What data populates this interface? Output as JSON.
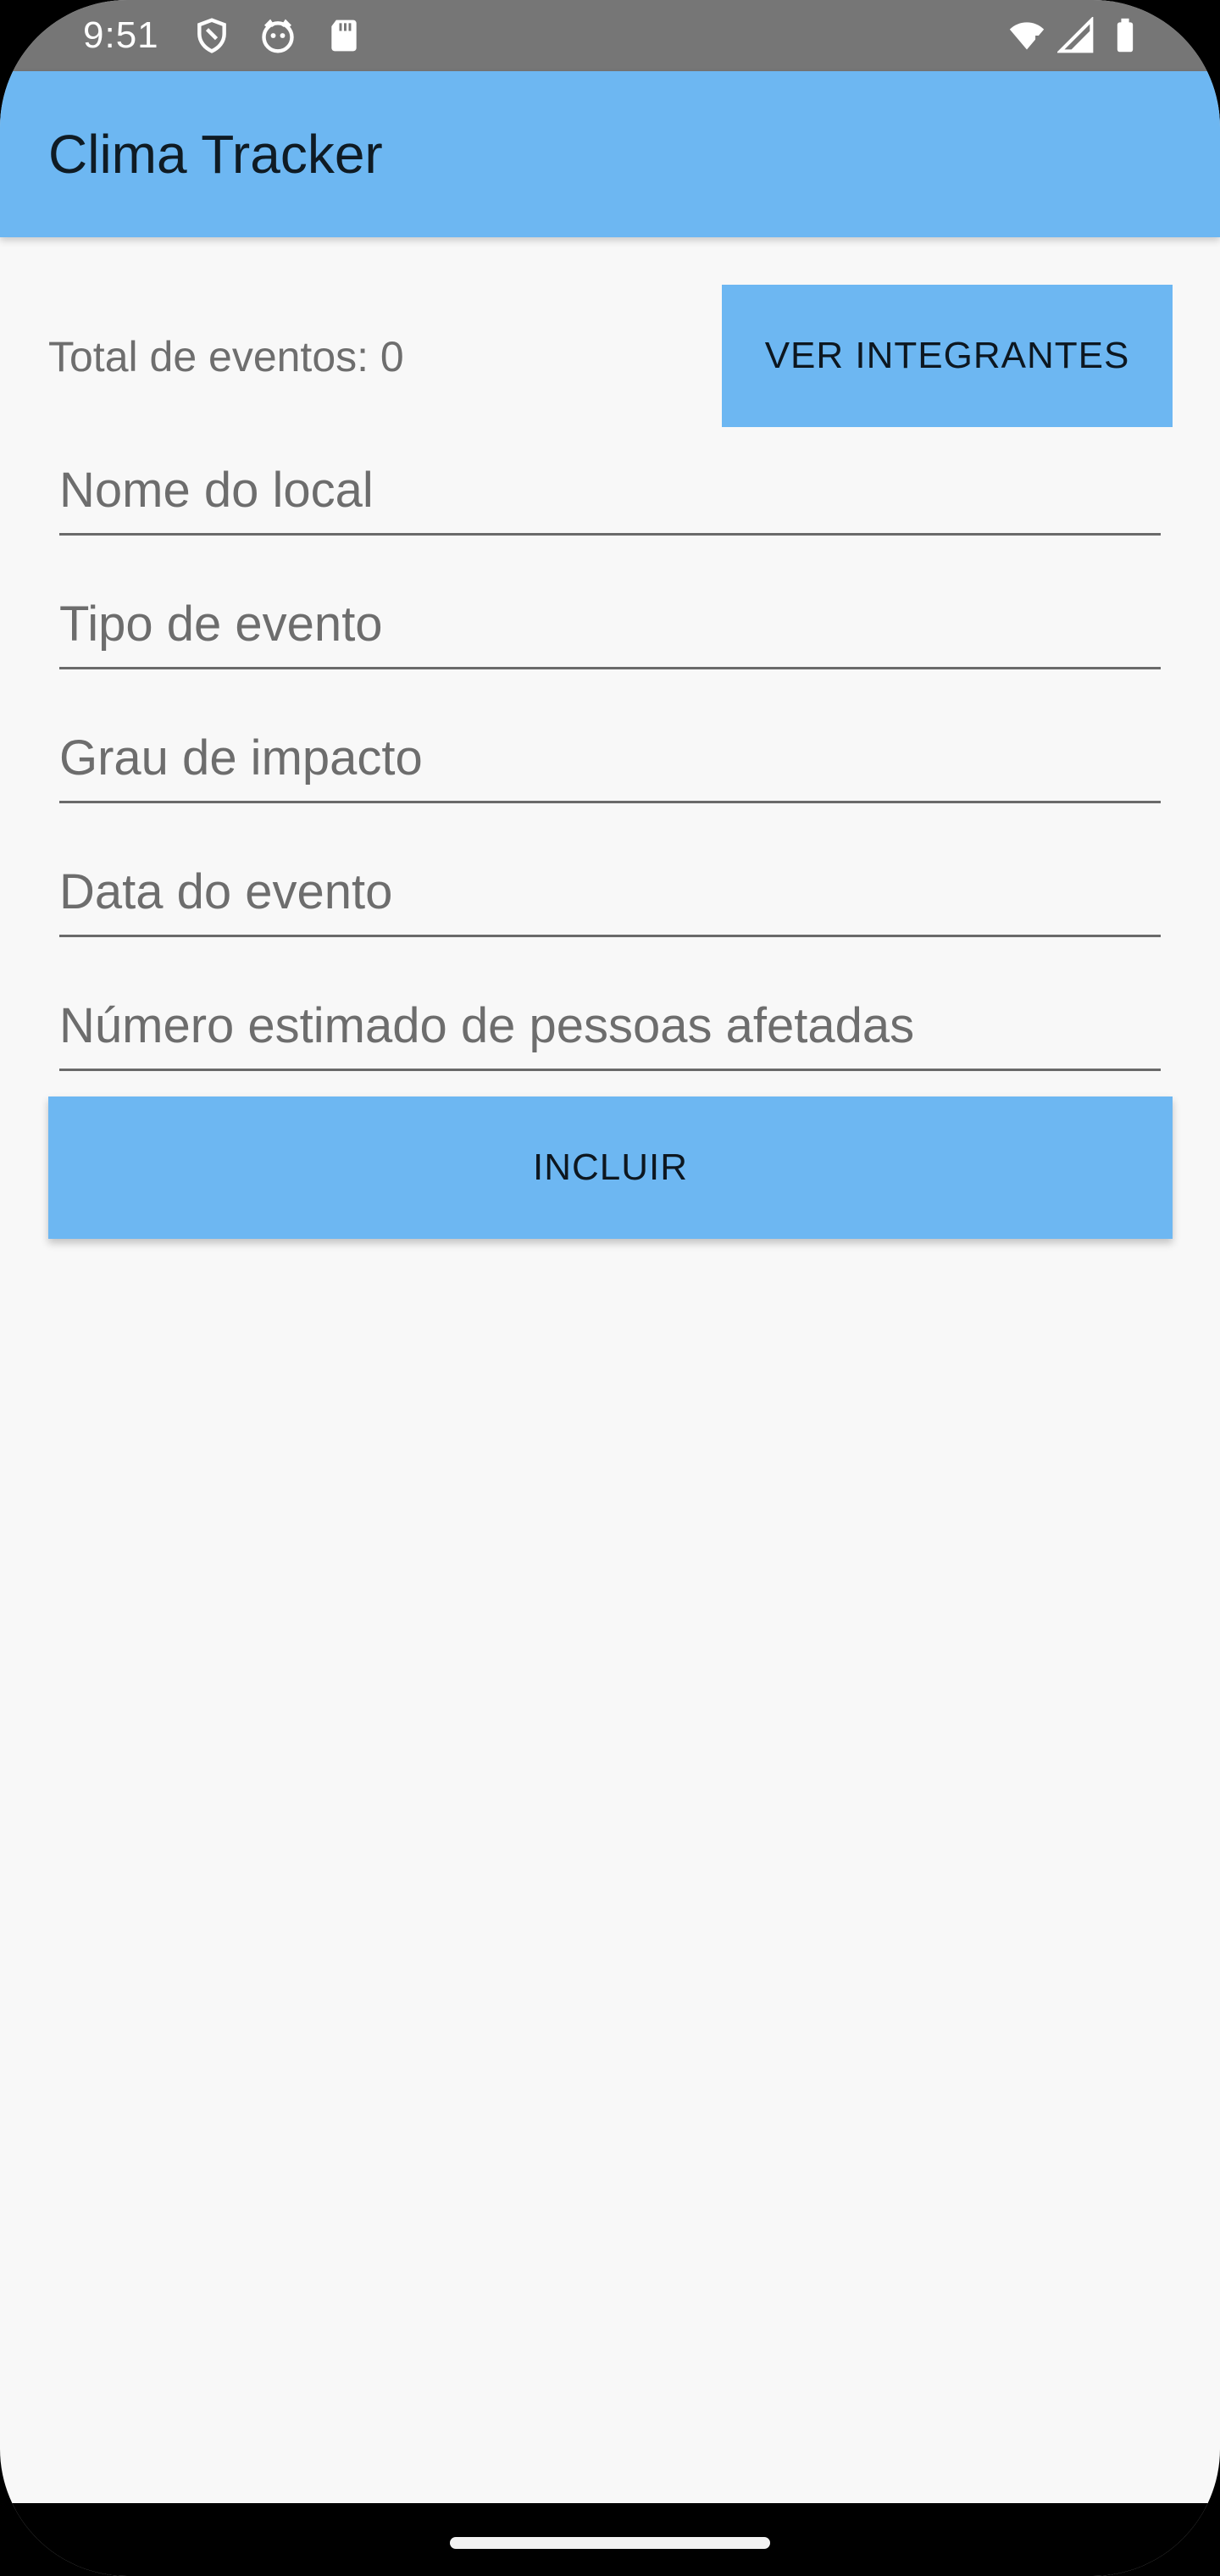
{
  "status_bar": {
    "time": "9:51",
    "icons": [
      "shield-icon",
      "cat-icon",
      "sd-card-icon",
      "wifi-icon",
      "signal-icon",
      "battery-icon"
    ],
    "color": "#767676"
  },
  "app_bar": {
    "title": "Clima Tracker",
    "color": "#6db7f2"
  },
  "summary": {
    "total_events_text": "Total de eventos: 0"
  },
  "buttons": {
    "ver_integrantes": "VER INTEGRANTES",
    "incluir": "INCLUIR"
  },
  "form": {
    "fields": [
      {
        "placeholder": "Nome do local",
        "value": ""
      },
      {
        "placeholder": "Tipo de evento",
        "value": ""
      },
      {
        "placeholder": "Grau de impacto",
        "value": ""
      },
      {
        "placeholder": "Data do evento",
        "value": ""
      },
      {
        "placeholder": "Número estimado de pessoas afetadas",
        "value": ""
      }
    ]
  },
  "colors": {
    "accent": "#6db7f2",
    "background": "#f8f8f8",
    "nav_bar": "#000000"
  }
}
